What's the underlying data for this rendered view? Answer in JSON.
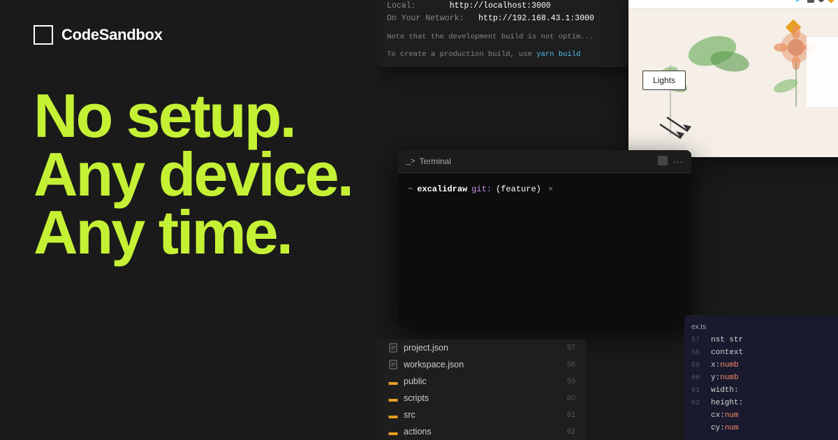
{
  "brand": {
    "logo_alt": "CodeSandbox",
    "logo_label": "CodeSandbox"
  },
  "hero": {
    "line1": "No setup.",
    "line2": "Any device.",
    "line3": "Any time."
  },
  "dev_server": {
    "local_label": "Local:",
    "local_url": "http://localhost:3000",
    "network_label": "On Your Network:",
    "network_url": "http://192.168.43.1:3000",
    "note1": "Note that the development build is not optim...",
    "note2": "To create a production build, use ",
    "yarn_cmd": "yarn build"
  },
  "drawing_app": {
    "lights_label": "Lights",
    "toolbar_icon1": "play-icon",
    "toolbar_icon2": "stop-icon",
    "toolbar_icon3": "diamond-icon",
    "toolbar_icon4": "arrow-right-icon"
  },
  "terminal": {
    "title": "Terminal",
    "prompt_tilde": "~",
    "prompt_dir": "excalidraw",
    "prompt_git_label": "git:",
    "prompt_branch": "(feature)",
    "prompt_cursor": "×"
  },
  "file_explorer": {
    "items": [
      {
        "name": "project.json",
        "type": "file",
        "line": "57"
      },
      {
        "name": "workspace.json",
        "type": "file",
        "line": "58"
      },
      {
        "name": "public",
        "type": "folder",
        "line": "59"
      },
      {
        "name": "scripts",
        "type": "folder",
        "line": "60"
      },
      {
        "name": "src",
        "type": "folder",
        "line": "61"
      },
      {
        "name": "actions",
        "type": "folder",
        "line": "62"
      }
    ]
  },
  "code_panel": {
    "filename": "ex.ts",
    "lines": [
      {
        "num": "57",
        "tokens": [
          {
            "text": "nst str",
            "cls": "kw-plain"
          }
        ]
      },
      {
        "num": "58",
        "tokens": [
          {
            "text": "context",
            "cls": "kw-plain"
          }
        ]
      },
      {
        "num": "59",
        "tokens": [
          {
            "text": "x: ",
            "cls": "kw-plain"
          },
          {
            "text": "numb",
            "cls": "kw-num"
          }
        ]
      },
      {
        "num": "60",
        "tokens": [
          {
            "text": "y: ",
            "cls": "kw-plain"
          },
          {
            "text": "numb",
            "cls": "kw-num"
          }
        ]
      },
      {
        "num": "61",
        "tokens": [
          {
            "text": "width:",
            "cls": "kw-plain"
          }
        ]
      },
      {
        "num": "62",
        "tokens": [
          {
            "text": "height:",
            "cls": "kw-plain"
          }
        ]
      },
      {
        "num": "",
        "tokens": [
          {
            "text": "cx: num",
            "cls": "kw-num"
          }
        ]
      },
      {
        "num": "",
        "tokens": [
          {
            "text": "cy: num",
            "cls": "kw-num"
          }
        ]
      }
    ]
  },
  "colors": {
    "accent": "#c5f135",
    "background": "#1a1a1a",
    "terminal_bg": "#0d0d0d"
  }
}
